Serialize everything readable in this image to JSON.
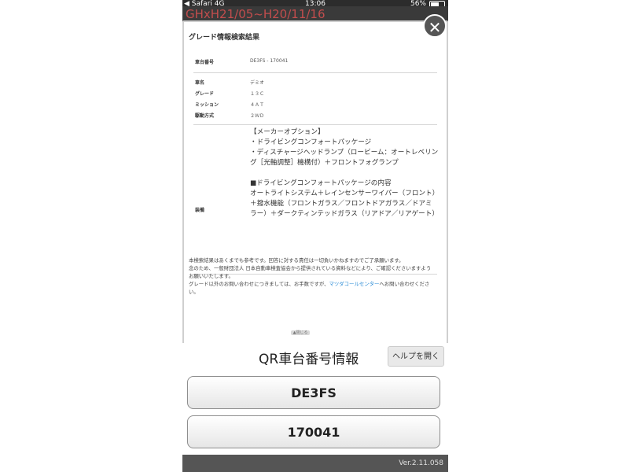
{
  "status_bar": {
    "app": "◀ Safari",
    "network": "4G",
    "time": "13:06",
    "battery": "56%"
  },
  "background": {
    "title": "GHxH21/05~H20/11/16"
  },
  "modal": {
    "title": "グレード情報検索結果",
    "rows": [
      {
        "label": "車台番号",
        "value": "DE3FS - 170041"
      },
      {
        "label": "車名",
        "value": "デミオ"
      },
      {
        "label": "グレード",
        "value": "１３Ｃ"
      },
      {
        "label": "ミッション",
        "value": "４ＡＴ"
      },
      {
        "label": "駆動方式",
        "value": "２ＷＤ"
      }
    ],
    "equipment_label": "装備",
    "equipment_value": "【メーカーオプション】\n・ドライビングコンフォートパッケージ\n・ディスチャージヘッドランプ（ロービーム：オートレベリング［光軸調整］機構付）＋フロントフォグランプ\n\n■ドライビングコンフォートパッケージの内容\nオートライトシステム＋レインセンサーワイパー（フロント）＋撥水機能（フロントガラス／フロントドアガラス／ドアミラー）＋ダークティンテッドガラス（リアドア／リアゲート）",
    "notes": [
      "本検索結果はあくまでも参考です。回答に対する責任は一切負いかねますのでご了承願います。",
      "念のため、一般財団法人 日本自動車検査協会から提供されている資料などにより、ご確認くださいますようお願いいたします。"
    ],
    "notes_last_prefix": "グレード以外のお問い合わせにつきましては、お手数ですが、",
    "notes_link": "マツダコールセンター",
    "notes_last_suffix": "へお問い合わせください。",
    "scroll_hint": "▲閉じる"
  },
  "qr": {
    "title": "QR車台番号情報",
    "help_label": "ヘルプを開く",
    "model_code": "DE3FS",
    "serial_number": "170041"
  },
  "footer": {
    "version": "Ver.2.11.058"
  },
  "colors": {
    "link": "#2a8bd6",
    "background_title": "#c24d4d"
  }
}
